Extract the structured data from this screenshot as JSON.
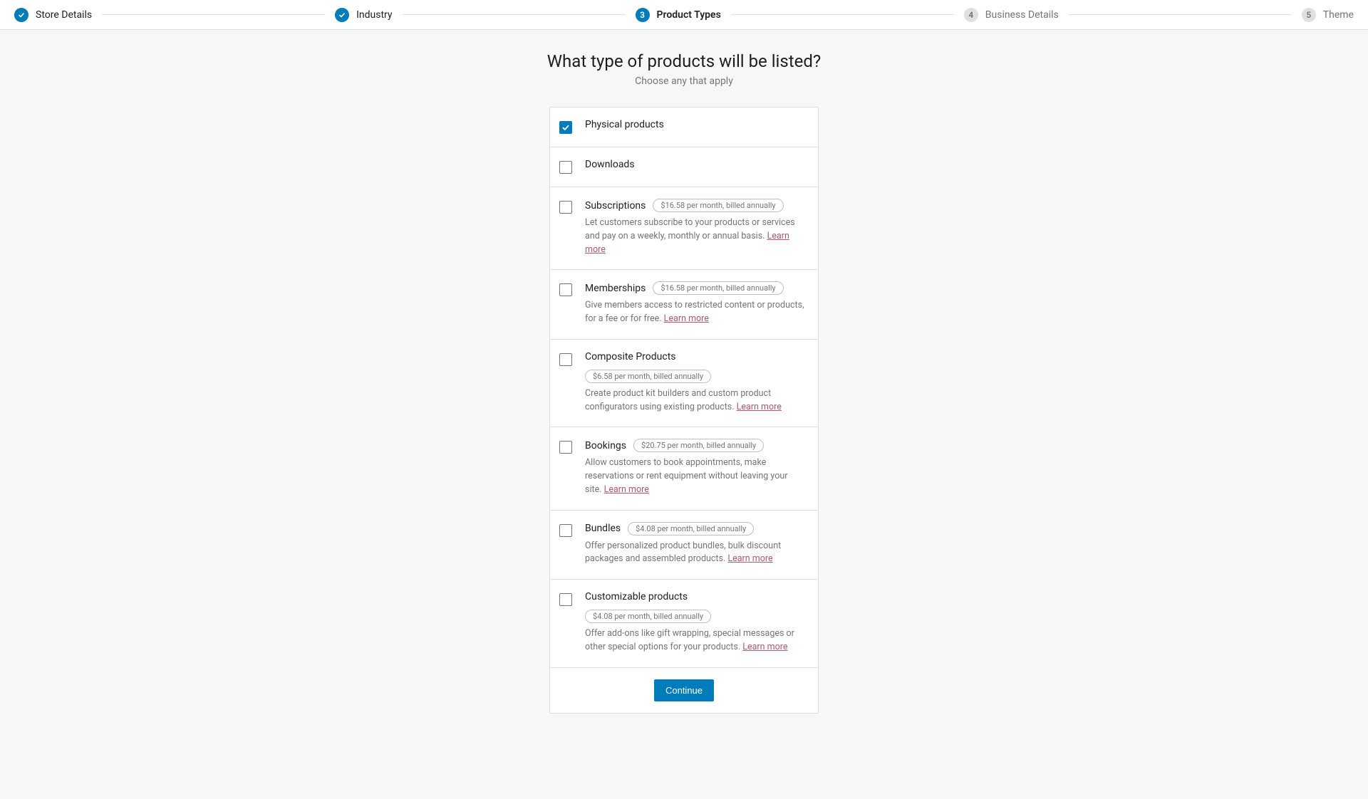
{
  "stepper": {
    "steps": [
      {
        "label": "Store Details",
        "state": "completed"
      },
      {
        "label": "Industry",
        "state": "completed"
      },
      {
        "label": "Product Types",
        "state": "current",
        "number": "3"
      },
      {
        "label": "Business Details",
        "state": "pending",
        "number": "4"
      },
      {
        "label": "Theme",
        "state": "pending",
        "number": "5"
      }
    ]
  },
  "header": {
    "title": "What type of products will be listed?",
    "subtitle": "Choose any that apply"
  },
  "options": [
    {
      "label": "Physical products",
      "checked": true
    },
    {
      "label": "Downloads",
      "checked": false
    },
    {
      "label": "Subscriptions",
      "checked": false,
      "price": "$16.58 per month, billed annually",
      "description": "Let customers subscribe to your products or services and pay on a weekly, monthly or annual basis.",
      "learn_more": "Learn more"
    },
    {
      "label": "Memberships",
      "checked": false,
      "price": "$16.58 per month, billed annually",
      "description": "Give members access to restricted content or products, for a fee or for free.",
      "learn_more": "Learn more"
    },
    {
      "label": "Composite Products",
      "checked": false,
      "price": "$6.58 per month, billed annually",
      "description": "Create product kit builders and custom product configurators using existing products.",
      "learn_more": "Learn more"
    },
    {
      "label": "Bookings",
      "checked": false,
      "price": "$20.75 per month, billed annually",
      "description": "Allow customers to book appointments, make reservations or rent equipment without leaving your site.",
      "learn_more": "Learn more"
    },
    {
      "label": "Bundles",
      "checked": false,
      "price": "$4.08 per month, billed annually",
      "description": "Offer personalized product bundles, bulk discount packages and assembled products.",
      "learn_more": "Learn more"
    },
    {
      "label": "Customizable products",
      "checked": false,
      "price": "$4.08 per month, billed annually",
      "description": "Offer add-ons like gift wrapping, special messages or other special options for your products.",
      "learn_more": "Learn more"
    }
  ],
  "continue_label": "Continue"
}
